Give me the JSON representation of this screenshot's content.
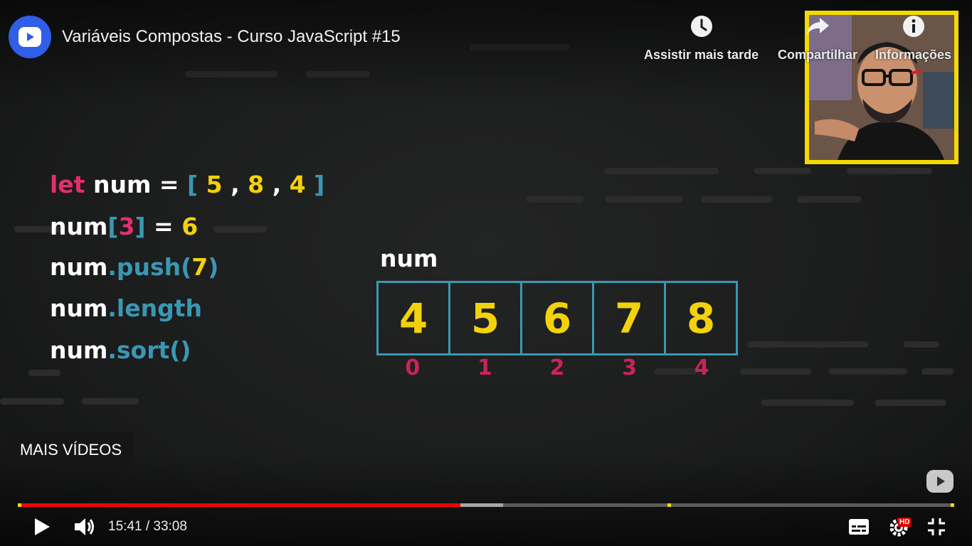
{
  "header": {
    "video_title": "Variáveis Compostas - Curso JavaScript #15",
    "actions": {
      "watch_later": "Assistir mais tarde",
      "share": "Compartilhar",
      "info": "Informações"
    }
  },
  "slide": {
    "code": {
      "line1": {
        "kw": "let",
        "var": "num",
        "eq": "=",
        "open": "[",
        "v1": "5",
        "v2": "8",
        "v3": "4",
        "close": "]",
        "comma": ","
      },
      "line2": {
        "var": "num",
        "open": "[",
        "index": "3",
        "close": "]",
        "eq": "=",
        "value": "6"
      },
      "line3": {
        "var": "num",
        "method": ".push(",
        "arg": "7",
        "end": ")"
      },
      "line4": {
        "var": "num",
        "prop": ".length"
      },
      "line5": {
        "var": "num",
        "method": ".sort()"
      }
    },
    "array_label": "num",
    "array_values": [
      "4",
      "5",
      "6",
      "7",
      "8"
    ],
    "array_indices": [
      "0",
      "1",
      "2",
      "3",
      "4"
    ]
  },
  "overlay": {
    "more_videos": "MAIS VÍDEOS"
  },
  "player": {
    "current_time": "15:41",
    "duration": "33:08",
    "time_text": "15:41 / 33:08",
    "played_fraction": 0.473,
    "buffered_fraction": 0.518,
    "chapter_fractions": [
      0.694
    ],
    "quality_badge": "HD",
    "colors": {
      "progress": "#ff0000",
      "marker": "#f5d800",
      "keyword": "#e0306b",
      "method": "#3a97b3",
      "number": "#f2d20c"
    },
    "icons": [
      "play-icon",
      "volume-icon",
      "subtitles-icon",
      "settings-icon",
      "exit-fullscreen-icon"
    ]
  }
}
